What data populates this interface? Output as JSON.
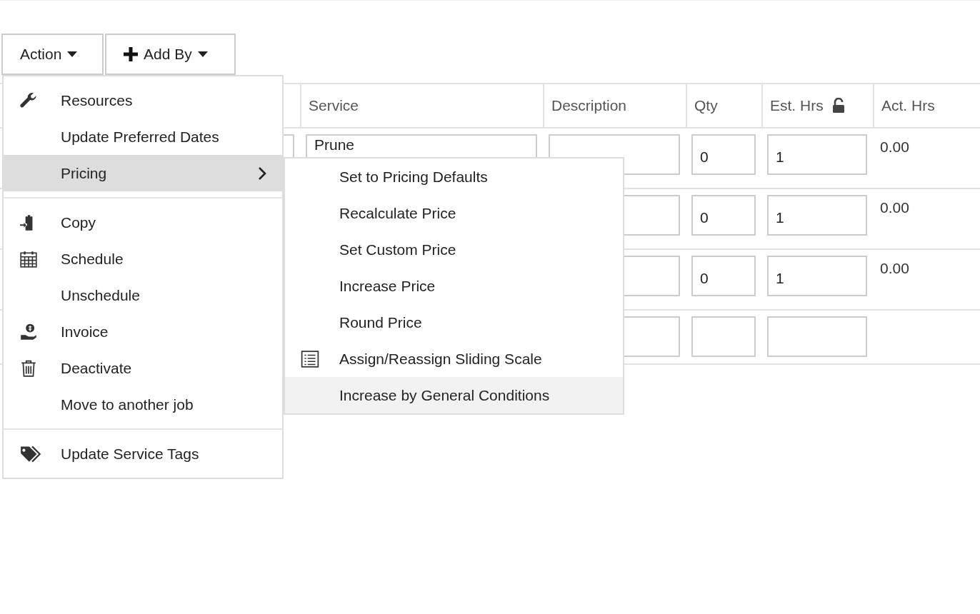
{
  "toolbar": {
    "buttons": [
      {
        "label": "Action",
        "kind": "dropdown"
      },
      {
        "label": "Add By",
        "kind": "add-dropdown"
      }
    ]
  },
  "table": {
    "columns": [
      {
        "label": "Service"
      },
      {
        "label": "Description"
      },
      {
        "label": "Qty"
      },
      {
        "label": "Est. Hrs",
        "locked": false
      },
      {
        "label": "Act. Hrs"
      }
    ],
    "rows": [
      {
        "service": "Prune",
        "qty": "0",
        "est_hrs": "1",
        "act_hrs": "0.00"
      },
      {
        "qty": "0",
        "est_hrs": "1",
        "act_hrs": "0.00"
      },
      {
        "qty": "0",
        "est_hrs": "1",
        "act_hrs": "0.00"
      },
      {}
    ]
  },
  "action_menu": {
    "groups": [
      [
        {
          "label": "Resources",
          "selected": false
        },
        {
          "label": "Update Preferred Dates",
          "selected": false
        },
        {
          "label": "Pricing",
          "selected": true,
          "children": [
            {
              "label": "Set to Pricing Defaults",
              "selected": false
            },
            {
              "label": "Recalculate Price",
              "selected": false
            },
            {
              "label": "Set Custom Price",
              "selected": false
            },
            {
              "label": "Increase Price",
              "selected": false
            },
            {
              "label": "Round Price",
              "selected": false
            },
            {
              "label": "Assign/Reassign Sliding Scale",
              "selected": false
            },
            {
              "label": "Increase by General Conditions",
              "selected": true
            }
          ]
        }
      ],
      [
        {
          "label": "Copy",
          "selected": false
        },
        {
          "label": "Schedule",
          "selected": false
        },
        {
          "label": "Unschedule",
          "selected": false
        },
        {
          "label": "Invoice",
          "selected": false
        },
        {
          "label": "Deactivate",
          "selected": false
        },
        {
          "label": "Move to another job",
          "selected": false
        }
      ],
      [
        {
          "label": "Update Service Tags",
          "selected": false
        }
      ]
    ]
  }
}
